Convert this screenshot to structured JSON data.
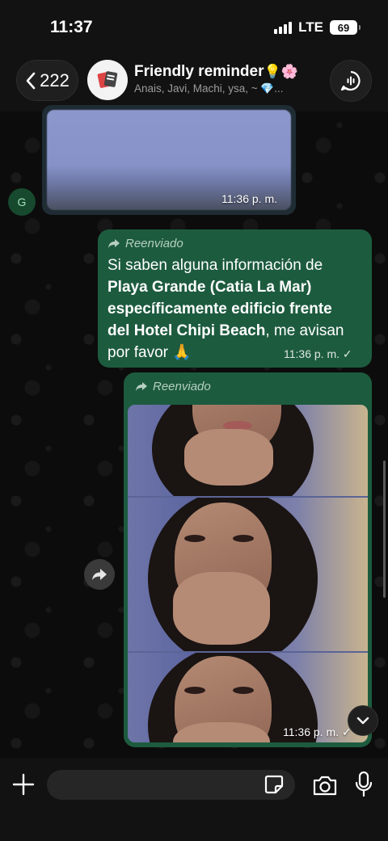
{
  "status_bar": {
    "time": "11:37",
    "network": "LTE",
    "battery": "69"
  },
  "header": {
    "back_count": "222",
    "group_name": "Friendly reminder",
    "group_emojis": "💡🌸",
    "members": "Anais, Javi, Machi, ysa, ~ 💎..."
  },
  "messages": [
    {
      "type": "image",
      "direction": "incoming",
      "sender_initial": "G",
      "time": "11:36 p. m."
    },
    {
      "type": "text",
      "direction": "outgoing",
      "forwarded_label": "Reenviado",
      "text_parts": [
        "Si saben alguna  información de ",
        "Playa Grande (Catia La Mar) específicamente edificio frente del Hotel Chipi Beach",
        ", me avisan por favor 🙏"
      ],
      "time": "11:36 p. m.",
      "status": "✓"
    },
    {
      "type": "image",
      "direction": "outgoing",
      "forwarded_label": "Reenviado",
      "time": "11:36 p. m.",
      "status": "✓"
    }
  ],
  "colors": {
    "outgoing_bubble": "#1d5b3f",
    "incoming_bubble": "#1f2c34",
    "background": "#0c0c0c"
  }
}
